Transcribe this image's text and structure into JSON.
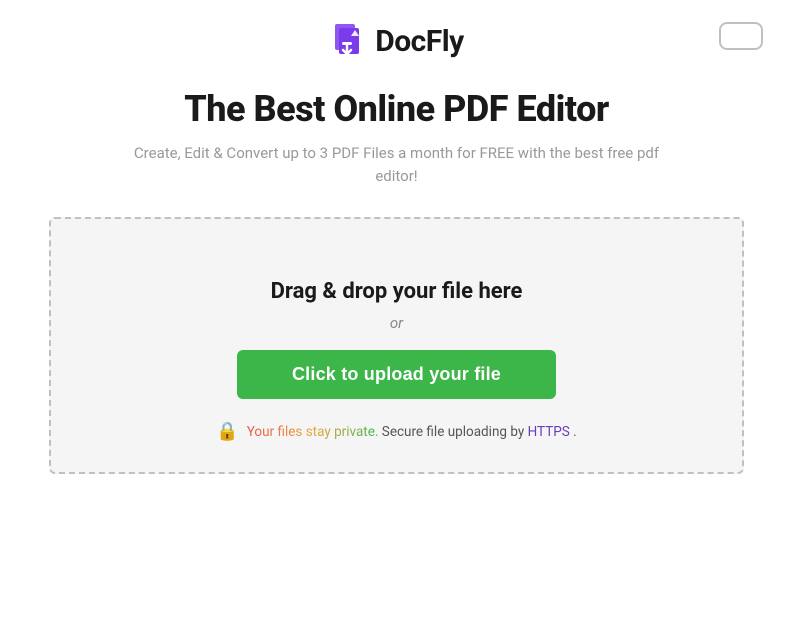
{
  "header": {
    "logo_text": "DocFly",
    "top_right_button_label": ""
  },
  "main": {
    "headline": "The Best Online PDF Editor",
    "subheadline": "Create, Edit & Convert up to 3 PDF Files a month for FREE with the best free pdf editor!",
    "dropzone": {
      "drag_drop_label": "Drag & drop your file here",
      "or_label": "or",
      "upload_button_label": "Click to upload your file",
      "security_text_before": "Your files stay private. Secure file uploading by ",
      "security_https": "HTTPS",
      "security_text_after": "."
    }
  }
}
